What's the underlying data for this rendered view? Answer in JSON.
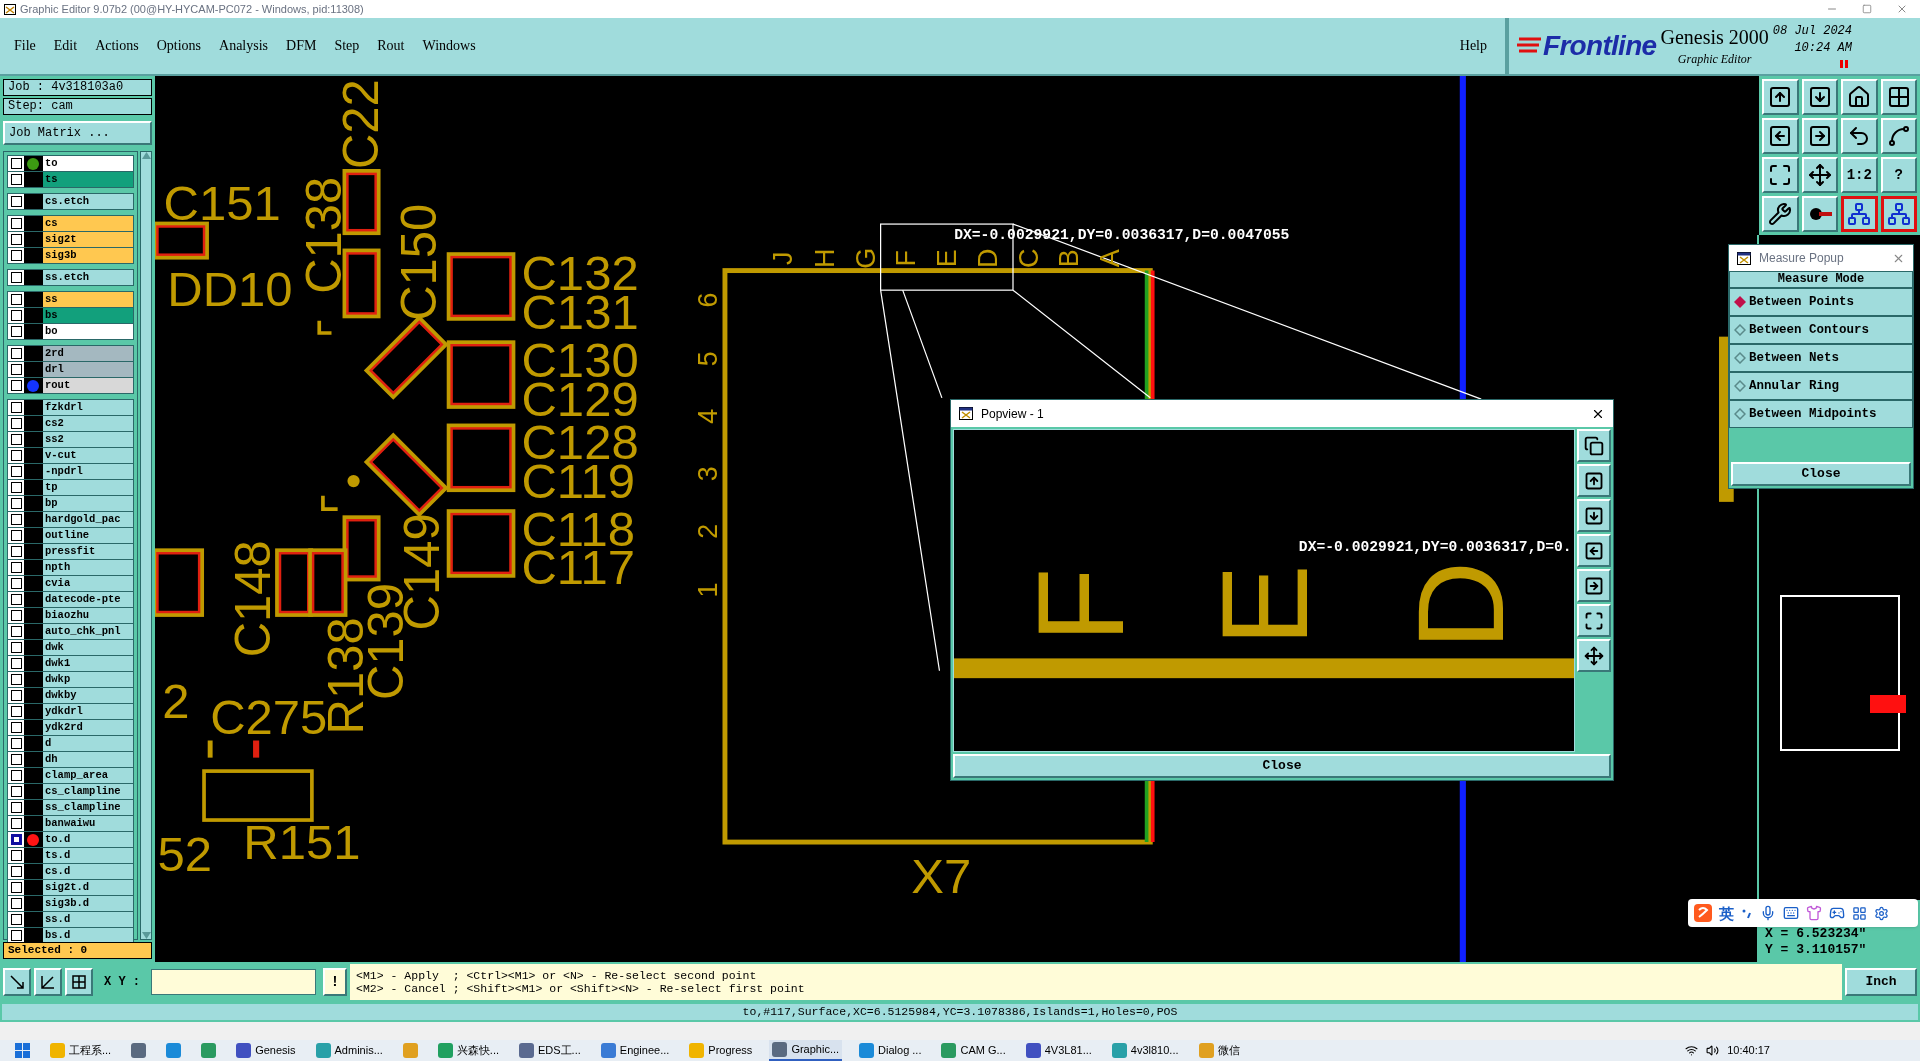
{
  "window": {
    "title": "Graphic Editor 9.07b2 (00@HY-HYCAM-PC072 - Windows, pid:11308)"
  },
  "menu": [
    "File",
    "Edit",
    "Actions",
    "Options",
    "Analysis",
    "DFM",
    "Step",
    "Rout",
    "Windows"
  ],
  "help_menu": "Help",
  "brand": {
    "logo": "Frontline",
    "product": "Genesis 2000",
    "subtitle": "Graphic Editor",
    "date": "08 Jul 2024",
    "time": "10:24 AM"
  },
  "job_panel": {
    "job": "Job : 4v318103a0",
    "step": "Step: cam",
    "matrix_button": "Job Matrix ...",
    "selected_count": "Selected : 0",
    "layer_groups": [
      {
        "layers": [
          {
            "name": "to",
            "color": "#ffffff",
            "dot": {
              "color": "#3c9a12"
            },
            "selected": false
          },
          {
            "name": "ts",
            "color": "#12a07c",
            "selected": false
          }
        ]
      },
      {
        "layers": [
          {
            "name": "cs.etch",
            "color": "#a0dcdc",
            "selected": false
          }
        ]
      },
      {
        "layers": [
          {
            "name": "cs",
            "color": "#ffc850",
            "selected": false
          },
          {
            "name": "sig2t",
            "color": "#ffc850",
            "selected": false
          },
          {
            "name": "sig3b",
            "color": "#ffc850",
            "selected": false
          }
        ]
      },
      {
        "layers": [
          {
            "name": "ss.etch",
            "color": "#a0dcdc",
            "selected": false
          }
        ]
      },
      {
        "layers": [
          {
            "name": "ss",
            "color": "#ffc850",
            "selected": false
          },
          {
            "name": "bs",
            "color": "#12a07c",
            "selected": false
          },
          {
            "name": "bo",
            "color": "#ffffff",
            "selected": false
          }
        ]
      },
      {
        "layers": [
          {
            "name": "2rd",
            "color": "#a4b8c0",
            "selected": false
          },
          {
            "name": "drl",
            "color": "#a4b8c0",
            "selected": false
          },
          {
            "name": "rout",
            "color": "#d8d8d8",
            "dot": {
              "color": "#1434ff"
            },
            "selected": false
          }
        ]
      },
      {
        "layers": [
          {
            "name": "fzkdrl",
            "color": "#a0dcdc",
            "selected": false
          },
          {
            "name": "cs2",
            "color": "#a0dcdc",
            "selected": false
          },
          {
            "name": "ss2",
            "color": "#a0dcdc",
            "selected": false
          },
          {
            "name": "v-cut",
            "color": "#a0dcdc",
            "selected": false
          },
          {
            "name": "-npdrl",
            "color": "#a0dcdc",
            "selected": false
          },
          {
            "name": "tp",
            "color": "#a0dcdc",
            "selected": false
          },
          {
            "name": "bp",
            "color": "#a0dcdc",
            "selected": false
          },
          {
            "name": "hardgold_pac",
            "color": "#a0dcdc",
            "selected": false
          },
          {
            "name": "outline",
            "color": "#a0dcdc",
            "selected": false
          },
          {
            "name": "pressfit",
            "color": "#a0dcdc",
            "selected": false
          },
          {
            "name": "npth",
            "color": "#a0dcdc",
            "selected": false
          },
          {
            "name": "cvia",
            "color": "#a0dcdc",
            "selected": false
          },
          {
            "name": "datecode-pte",
            "color": "#a0dcdc",
            "selected": false
          },
          {
            "name": "biaozhu",
            "color": "#a0dcdc",
            "selected": false
          },
          {
            "name": "auto_chk_pnl",
            "color": "#a0dcdc",
            "selected": false
          },
          {
            "name": "dwk",
            "color": "#a0dcdc",
            "selected": false
          },
          {
            "name": "dwk1",
            "color": "#a0dcdc",
            "selected": false
          },
          {
            "name": "dwkp",
            "color": "#a0dcdc",
            "selected": false
          },
          {
            "name": "dwkby",
            "color": "#a0dcdc",
            "selected": false
          },
          {
            "name": "ydkdrl",
            "color": "#a0dcdc",
            "selected": false
          },
          {
            "name": "ydk2rd",
            "color": "#a0dcdc",
            "selected": false
          },
          {
            "name": "d",
            "color": "#a0dcdc",
            "selected": false
          },
          {
            "name": "dh",
            "color": "#a0dcdc",
            "selected": false
          },
          {
            "name": "clamp_area",
            "color": "#a0dcdc",
            "selected": false
          },
          {
            "name": "cs_clampline",
            "color": "#a0dcdc",
            "selected": false
          },
          {
            "name": "ss_clampline",
            "color": "#a0dcdc",
            "selected": false
          },
          {
            "name": "banwaiwu",
            "color": "#a0dcdc",
            "selected": false
          },
          {
            "name": "to.d",
            "color": "#a0dcdc",
            "dot": {
              "color": "#ff1414"
            },
            "selected": true
          },
          {
            "name": "ts.d",
            "color": "#a0dcdc",
            "selected": false
          },
          {
            "name": "cs.d",
            "color": "#a0dcdc",
            "selected": false
          },
          {
            "name": "sig2t.d",
            "color": "#a0dcdc",
            "selected": false
          },
          {
            "name": "sig3b.d",
            "color": "#a0dcdc",
            "selected": false
          },
          {
            "name": "ss.d",
            "color": "#a0dcdc",
            "selected": false
          },
          {
            "name": "bs.d",
            "color": "#a0dcdc",
            "selected": false
          }
        ]
      }
    ]
  },
  "canvas": {
    "labels": [
      "C22",
      "C151",
      "C138",
      "C150",
      "DD10",
      "C132",
      "C131",
      "C130",
      "C129",
      "C128",
      "C119",
      "C118",
      "C117",
      "C149",
      "C148",
      "C139",
      "R138",
      "C275",
      "R151",
      "2",
      "52",
      "X7"
    ],
    "column_letters": [
      "J",
      "H",
      "G",
      "F",
      "E",
      "D",
      "C",
      "B",
      "A"
    ],
    "row_numbers": [
      "6",
      "5",
      "4",
      "3",
      "2",
      "1"
    ],
    "measurement": "DX=-0.0029921,DY=0.0036317,D=0.0047055"
  },
  "popview": {
    "title": "Popview - 1",
    "letters": [
      "F",
      "E",
      "D"
    ],
    "measurement": "DX=-0.0029921,DY=0.0036317,D=0.",
    "close_button": "Close"
  },
  "toolbar": [
    {
      "active": false
    },
    {
      "active": false
    },
    {
      "active": false
    },
    {
      "active": false
    },
    {
      "active": false
    },
    {
      "active": false
    },
    {
      "active": false
    },
    {
      "active": false
    },
    {
      "active": false
    },
    {
      "active": false
    },
    {
      "active": false,
      "label": "1:2"
    },
    {
      "active": false,
      "label": "?"
    },
    {
      "active": false
    },
    {
      "active": false
    },
    {
      "active": true
    },
    {
      "active": true
    }
  ],
  "measure_popup": {
    "title": "Measure Popup",
    "heading": "Measure Mode",
    "options": [
      {
        "label": "Between Points",
        "selected": true
      },
      {
        "label": "Between Contours",
        "selected": false
      },
      {
        "label": "Between Nets",
        "selected": false
      },
      {
        "label": "Annular Ring",
        "selected": false
      },
      {
        "label": "Between Midpoints",
        "selected": false
      }
    ],
    "close_button": "Close"
  },
  "ime_bar": {
    "language": "英"
  },
  "coordinates": {
    "x": "X = 6.523234\"",
    "y": "Y = 3.110157\""
  },
  "command_bar": {
    "xy_label": "X Y :",
    "confirm_button": "!",
    "prompt": [
      "<M1> - Apply  ; <Ctrl><M1> or <N> - Re-select second point",
      "<M2> - Cancel ; <Shift><M1> or <Shift><N> - Re-select first point"
    ],
    "units_button": "Inch"
  },
  "status_bar": "to,#117,Surface,XC=6.5125984,YC=3.1078386,Islands=1,Holes=0,POS",
  "taskbar": {
    "items": [
      {
        "kind": "start",
        "selected": false
      },
      {
        "kind": "window",
        "label": "工程系...",
        "selected": false
      },
      {
        "kind": "icon",
        "selected": false
      },
      {
        "kind": "icon",
        "selected": false
      },
      {
        "kind": "icon",
        "selected": false
      },
      {
        "kind": "window",
        "label": "Genesis",
        "selected": false
      },
      {
        "kind": "window",
        "label": "Adminis...",
        "selected": false
      },
      {
        "kind": "icon",
        "selected": false
      },
      {
        "kind": "window",
        "label": "兴森快...",
        "selected": false
      },
      {
        "kind": "window",
        "label": "EDS工...",
        "selected": false
      },
      {
        "kind": "window",
        "label": "Enginee...",
        "selected": false
      },
      {
        "kind": "window",
        "label": "Progress",
        "selected": false
      },
      {
        "kind": "window",
        "label": "Graphic...",
        "selected": true
      },
      {
        "kind": "window",
        "label": "Dialog ...",
        "selected": false
      },
      {
        "kind": "window",
        "label": "CAM G...",
        "selected": false
      },
      {
        "kind": "window",
        "label": "4V3L81...",
        "selected": false
      },
      {
        "kind": "window",
        "label": "4v3l810...",
        "selected": false
      },
      {
        "kind": "window",
        "label": "微信",
        "selected": false
      }
    ],
    "clock": "10:40:17"
  }
}
